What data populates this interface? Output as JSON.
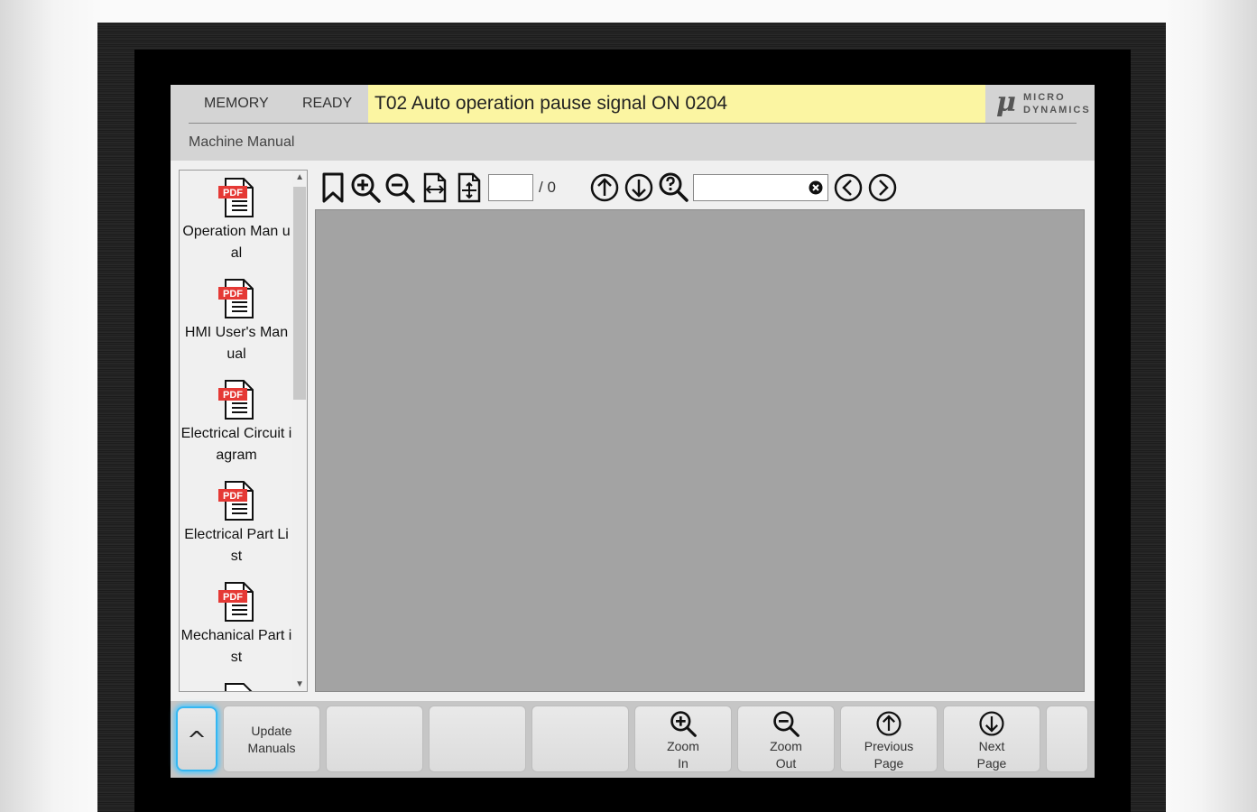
{
  "header": {
    "mode": "MEMORY",
    "state": "READY",
    "alarm": "T02  Auto operation pause signal ON 0204",
    "logo_line1": "MICRO",
    "logo_line2": "DYNAMICS",
    "screen_title": "Machine Manual"
  },
  "documents": [
    {
      "label": "Operation Manual",
      "display": "Operation Man ual",
      "icon": "pdf-icon"
    },
    {
      "label": "HMI User's Manual",
      "display": "HMI User's Man ual",
      "icon": "pdf-icon"
    },
    {
      "label": "Electrical Circuit iagram",
      "display": "Electrical Circuit iagram",
      "icon": "pdf-icon"
    },
    {
      "label": "Electrical Part List",
      "display": "Electrical Part Li st",
      "icon": "pdf-icon"
    },
    {
      "label": "Mechanical Part ist",
      "display": "Mechanical Part ist",
      "icon": "pdf-icon"
    }
  ],
  "pdf_badge": "PDF",
  "toolbar": {
    "page_value": "",
    "page_total": "/ 0",
    "search_value": ""
  },
  "softkeys": {
    "expand": "^",
    "update": [
      "Update",
      "Manuals"
    ],
    "zoom_in": [
      "Zoom",
      "In"
    ],
    "zoom_out": [
      "Zoom",
      "Out"
    ],
    "prev_page": [
      "Previous",
      "Page"
    ],
    "next_page": [
      "Next",
      "Page"
    ]
  },
  "colors": {
    "alarm_bg": "#fbf5a2",
    "pdf_red": "#e53935",
    "focus_glow": "#35b7f2",
    "viewer_bg": "#a3a3a3"
  }
}
